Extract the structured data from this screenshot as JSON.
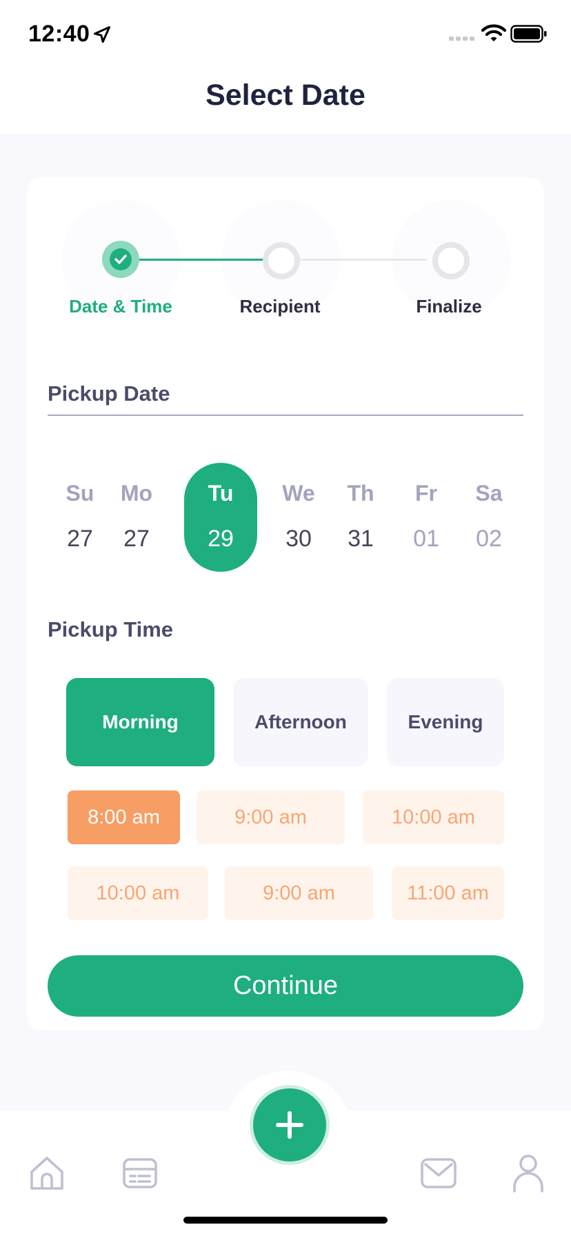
{
  "status_bar": {
    "time": "12:40"
  },
  "header": {
    "title": "Select Date"
  },
  "stepper": {
    "steps": [
      {
        "label": "Date & Time",
        "state": "completed"
      },
      {
        "label": "Recipient",
        "state": "pending"
      },
      {
        "label": "Finalize",
        "state": "pending"
      }
    ]
  },
  "pickup_date": {
    "label": "Pickup Date",
    "days": [
      {
        "name": "Su",
        "num": "27"
      },
      {
        "name": "Mo",
        "num": "27"
      },
      {
        "name": "Tu",
        "num": "29",
        "selected": true
      },
      {
        "name": "We",
        "num": "30"
      },
      {
        "name": "Th",
        "num": "31"
      },
      {
        "name": "Fr",
        "num": "01",
        "muted": true
      },
      {
        "name": "Sa",
        "num": "02",
        "muted": true
      }
    ]
  },
  "pickup_time": {
    "label": "Pickup Time",
    "segments": [
      "Morning",
      "Afternoon",
      "Evening"
    ],
    "selected_segment": "Morning",
    "slots": [
      "8:00 am",
      "9:00 am",
      "10:00 am",
      "10:00 am",
      "9:00 am",
      "11:00 am"
    ],
    "selected_slot": "8:00 am"
  },
  "continue_label": "Continue",
  "bottom_nav": {
    "items": [
      "home-icon",
      "ticket-icon",
      "add-icon",
      "mail-icon",
      "profile-icon"
    ]
  },
  "colors": {
    "accent_green": "#1eae7f",
    "accent_orange": "#f79e65",
    "text_dark": "#1f2340"
  }
}
